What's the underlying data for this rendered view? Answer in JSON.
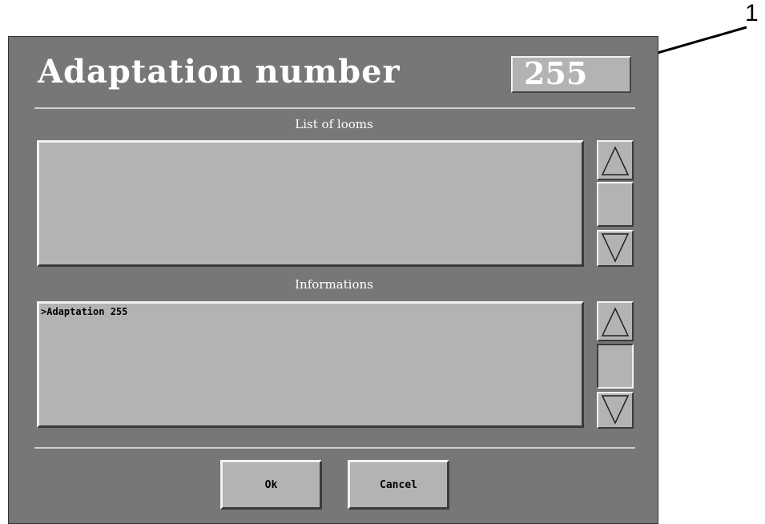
{
  "callout": {
    "label": "1"
  },
  "dialog": {
    "title": "Adaptation number",
    "number_value": "255"
  },
  "looms": {
    "section_label": "List of looms",
    "items": []
  },
  "informations": {
    "section_label": "Informations",
    "lines": [
      ">Adaptation 255"
    ]
  },
  "buttons": {
    "ok_label": "Ok",
    "cancel_label": "Cancel"
  },
  "colors": {
    "dialog_bg": "#777777",
    "field_bg": "#b3b3b3",
    "title_text": "#ffffff"
  },
  "icons": {
    "scroll_up": "triangle-up-icon",
    "scroll_down": "triangle-down-icon"
  }
}
